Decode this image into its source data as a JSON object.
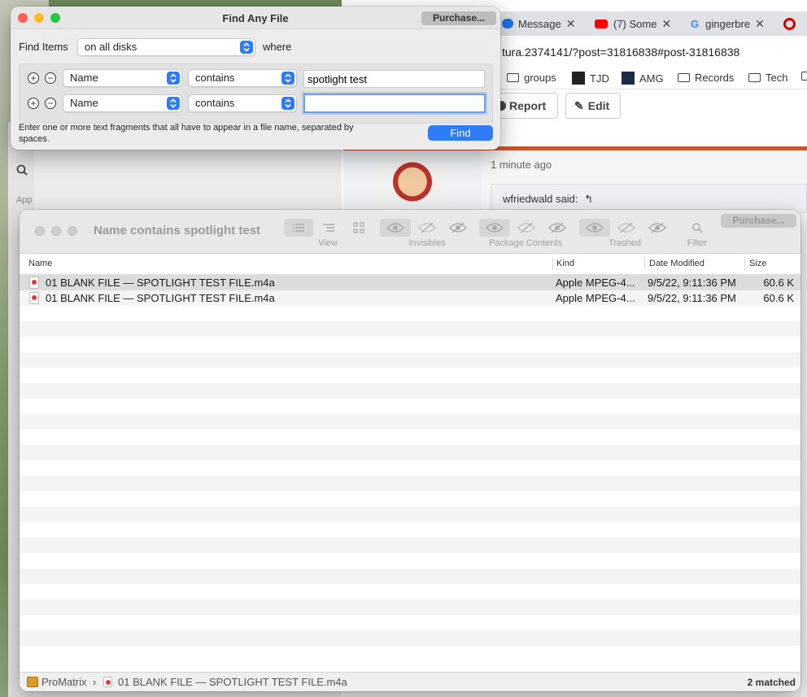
{
  "find_window": {
    "title": "Find Any File",
    "purchase_label": "Purchase...",
    "find_items_label": "Find Items",
    "scope_value": "on all disks",
    "where_label": "where",
    "criteria": [
      {
        "attribute": "Name",
        "operator": "contains",
        "value": "spotlight test"
      },
      {
        "attribute": "Name",
        "operator": "contains",
        "value": ""
      }
    ],
    "hint": "Enter one or more text fragments that all have to appear in a file name, separated by spaces.",
    "find_label": "Find"
  },
  "results_window": {
    "title": "Name contains spotlight test",
    "purchase_label": "Purchase...",
    "toolbar_groups": [
      "View",
      "Invisibles",
      "Package Contents",
      "Trashed",
      "Filter"
    ],
    "columns": [
      "Name",
      "Kind",
      "Date Modified",
      "Size"
    ],
    "rows": [
      {
        "name": "01 BLANK FILE — SPOTLIGHT TEST FILE.m4a",
        "kind": "Apple MPEG-4...",
        "date": "9/5/22, 9:11:36 PM",
        "size": "60.6 K"
      },
      {
        "name": "01 BLANK FILE — SPOTLIGHT TEST FILE.m4a",
        "kind": "Apple MPEG-4...",
        "date": "9/5/22, 9:11:36 PM",
        "size": "60.6 K"
      }
    ],
    "path_root": "ProMatrix",
    "path_sep": "›",
    "path_file": "01 BLANK FILE — SPOTLIGHT TEST FILE.m4a",
    "matched": "2 matched"
  },
  "browser": {
    "tabs": [
      "Message",
      "(7) Some",
      "gingerbre"
    ],
    "url": "tura.2374141/?post=31816838#post-31816838",
    "bookmarks": [
      "groups",
      "TJD",
      "AMG",
      "Records",
      "Tech"
    ],
    "report_label": "Report",
    "edit_label": "Edit",
    "time_ago": "1 minute ago",
    "quote_author": "wfriedwald said:"
  },
  "background": {
    "label_app": "App"
  },
  "colors": {
    "accent": "#2f7cf6",
    "close": "#fe5f57",
    "minimize": "#febc2e",
    "zoom": "#28c840",
    "forum_bar": "#c5572f"
  }
}
